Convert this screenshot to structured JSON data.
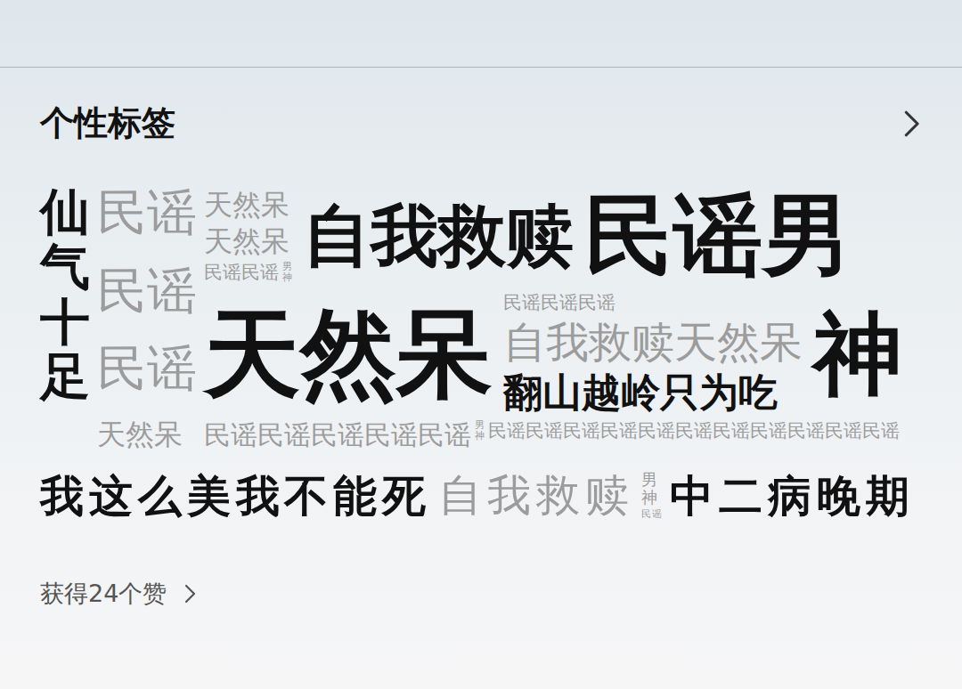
{
  "header": {
    "title": "个性标签"
  },
  "tag_cloud": {
    "side_row": [
      [
        [
          {
            "text": "仙气十足",
            "kind": "vertical",
            "emphasized": true,
            "level": 0.52
          }
        ]
      ],
      [
        [
          {
            "text": "民谣",
            "kind": "horizontal",
            "emphasized": false,
            "level": 0.52
          }
        ],
        [
          {
            "text": "民谣",
            "kind": "horizontal",
            "emphasized": false,
            "level": 0.52
          }
        ],
        [
          {
            "text": "民谣",
            "kind": "horizontal",
            "emphasized": false,
            "level": 0.52
          }
        ],
        [
          {
            "text": "天然呆",
            "kind": "horizontal",
            "emphasized": false,
            "level": 0.3
          }
        ]
      ]
    ],
    "main_rows": [
      [
        [
          [
            {
              "text": "天然呆",
              "kind": "horizontal",
              "emphasized": false,
              "level": 0.3
            }
          ],
          [
            {
              "text": "天然呆",
              "kind": "horizontal",
              "emphasized": false,
              "level": 0.3
            }
          ],
          [
            {
              "text": "民谣民谣",
              "kind": "horizontal",
              "emphasized": false,
              "level": 0.19
            },
            {
              "text": "男神",
              "kind": "vertical",
              "emphasized": false,
              "level": 0.1
            }
          ]
        ],
        [
          [
            {
              "text": "自我救赎",
              "kind": "horizontal",
              "emphasized": true,
              "level": 0.7
            }
          ]
        ],
        [
          [
            {
              "text": "民谣男",
              "kind": "horizontal",
              "emphasized": true,
              "level": 0.93
            }
          ]
        ]
      ],
      [
        [
          [
            {
              "text": "天然呆",
              "kind": "horizontal",
              "emphasized": true,
              "level": 1.0
            }
          ]
        ],
        [
          [
            {
              "text": "民谣民谣民谣",
              "kind": "horizontal",
              "emphasized": false,
              "level": 0.19
            }
          ],
          [
            {
              "text": "自我救赎天然呆",
              "kind": "horizontal",
              "emphasized": false,
              "level": 0.44
            }
          ],
          [
            {
              "text": "翻山越岭只为吃",
              "kind": "horizontal",
              "emphasized": true,
              "level": 0.41
            }
          ]
        ],
        [
          [
            {
              "text": "神",
              "kind": "horizontal",
              "emphasized": true,
              "level": 0.93
            }
          ]
        ]
      ],
      [
        [
          [
            {
              "text": "民谣民谣民谣民谣民谣",
              "kind": "horizontal",
              "emphasized": false,
              "level": 0.28
            },
            {
              "text": "男神",
              "kind": "vertical",
              "emphasized": false,
              "level": 0.1
            },
            {
              "text": "民谣民谣民谣民谣民谣民谣民谣民谣民谣民谣民谣",
              "kind": "horizontal",
              "emphasized": false,
              "level": 0.19
            }
          ]
        ]
      ]
    ],
    "bottom_row": [
      [
        [
          {
            "text": "我这么美我不能死",
            "kind": "horizontal",
            "emphasized": true,
            "level": 0.45
          }
        ]
      ],
      [
        [
          {
            "text": "自我救赎",
            "kind": "horizontal",
            "emphasized": false,
            "level": 0.45
          }
        ]
      ],
      [
        [
          {
            "text": "男神",
            "kind": "vertical",
            "emphasized": false,
            "level": 0.17
          }
        ],
        [
          {
            "text": "民谣",
            "kind": "horizontal",
            "emphasized": false,
            "level": 0.1
          }
        ]
      ],
      [
        [
          {
            "text": "中二病晚期",
            "kind": "horizontal",
            "emphasized": true,
            "level": 0.45
          }
        ]
      ]
    ]
  },
  "footer": {
    "likes_label": "获得24个赞"
  }
}
